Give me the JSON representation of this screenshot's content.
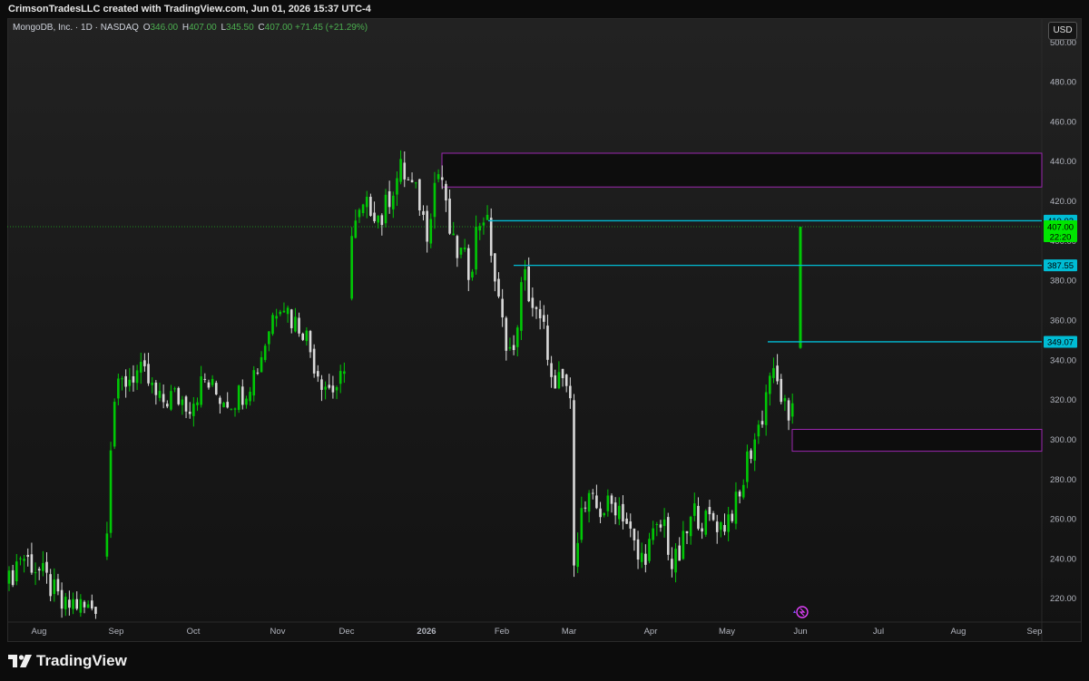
{
  "header": {
    "attribution": "CrimsonTradesLLC created with TradingView.com, Jun 01, 2026 15:37 UTC-4"
  },
  "legend": {
    "symbol": "MongoDB, Inc. · 1D · NASDAQ",
    "open_label": "O",
    "open": "346.00",
    "high_label": "H",
    "high": "407.00",
    "low_label": "L",
    "low": "345.50",
    "close_label": "C",
    "close": "407.00",
    "change": "+71.45 (+21.29%)"
  },
  "currency": "USD",
  "footer": {
    "brand": "TradingView"
  },
  "colors": {
    "up": "#00c805",
    "down": "#d9d9d9",
    "zone_border": "#9c27b0",
    "level_line": "#00bcd4",
    "price_label_bg": "#00e600"
  },
  "chart_data": {
    "type": "candlestick",
    "symbol": "MongoDB, Inc.",
    "interval": "1D",
    "exchange": "NASDAQ",
    "x_labels": [
      "Aug",
      "Sep",
      "Oct",
      "Nov",
      "Dec",
      "2026",
      "Feb",
      "Mar",
      "Apr",
      "May",
      "Jun",
      "Jul",
      "Aug",
      "Sep"
    ],
    "y_ticks": [
      "220.00",
      "240.00",
      "260.00",
      "280.00",
      "300.00",
      "320.00",
      "340.00",
      "360.00",
      "380.00",
      "400.00",
      "420.00",
      "440.00",
      "460.00",
      "480.00",
      "500.00"
    ],
    "ylim": [
      208,
      512
    ],
    "last_price": {
      "value": "407.00",
      "countdown": "22:20"
    },
    "horizontal_levels": [
      {
        "value": "410.02"
      },
      {
        "value": "387.55"
      },
      {
        "value": "349.07"
      }
    ],
    "zones": [
      {
        "top": 444,
        "bottom": 427
      },
      {
        "top": 305,
        "bottom": 294
      }
    ],
    "last_bar": {
      "open": 346.0,
      "high": 407.0,
      "low": 345.5,
      "close": 407.0
    }
  }
}
